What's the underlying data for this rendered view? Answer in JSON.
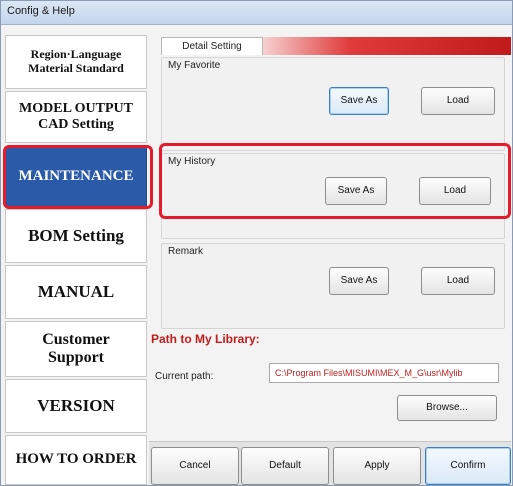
{
  "window": {
    "title": "Config & Help"
  },
  "sidebar": {
    "items": [
      {
        "lines": [
          "Region·Language",
          "Material Standard"
        ]
      },
      {
        "lines": [
          "MODEL OUTPUT",
          "CAD Setting"
        ]
      },
      {
        "lines": [
          "MAINTENANCE"
        ],
        "active": true
      },
      {
        "lines": [
          "BOM Setting"
        ]
      },
      {
        "lines": [
          "MANUAL"
        ]
      },
      {
        "lines": [
          "Customer",
          "Support"
        ]
      },
      {
        "lines": [
          "VERSION"
        ]
      },
      {
        "lines": [
          "HOW TO ORDER"
        ]
      }
    ]
  },
  "tab": {
    "label": "Detail Setting"
  },
  "favorite": {
    "label": "My Favorite",
    "save_as": "Save As",
    "load": "Load"
  },
  "history": {
    "label": "My History",
    "save_as": "Save As",
    "load": "Load"
  },
  "remark": {
    "label": "Remark",
    "save_as": "Save As",
    "load": "Load"
  },
  "library": {
    "title": "Path to My Library:",
    "current_path_label": "Current path:",
    "current_path_value": "C:\\Program Files\\MISUMI\\MEX_M_G\\usr\\Mylib",
    "browse": "Browse..."
  },
  "bottom": {
    "cancel": "Cancel",
    "default": "Default",
    "apply": "Apply",
    "confirm": "Confirm"
  },
  "colors": {
    "accent_red": "#e41b2a",
    "active_blue": "#2a5aa8",
    "path_red": "#c21d1d"
  }
}
